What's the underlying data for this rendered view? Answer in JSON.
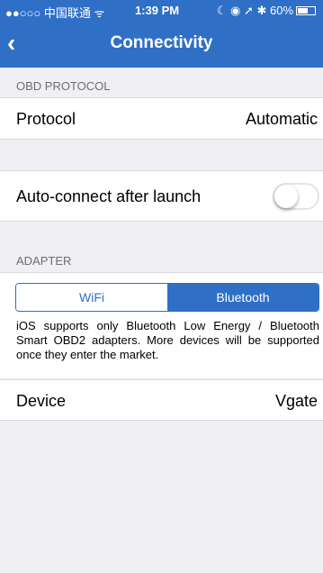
{
  "status_bar": {
    "carrier": "●●○○○ 中国联通 ᯤ",
    "time": "1:39 PM",
    "indicators": "☾ ◉ ➚ ✱ 60%",
    "battery_level": 0.6
  },
  "nav": {
    "back_icon": "chevron-left-icon",
    "title": "Connectivity"
  },
  "obd": {
    "section_label": "OBD PROTOCOL",
    "protocol_label": "Protocol",
    "protocol_value": "Automatic"
  },
  "auto_connect": {
    "label": "Auto-connect after launch",
    "enabled": false
  },
  "adapter": {
    "section_label": "ADAPTER",
    "options": [
      "WiFi",
      "Bluetooth"
    ],
    "selected": "Bluetooth",
    "note": "iOS supports only Bluetooth Low Energy / Bluetooth Smart OBD2 adapters. More devices will be supported once they enter the market."
  },
  "device": {
    "label": "Device",
    "value": "Vgate"
  },
  "colors": {
    "accent": "#2f6fc6",
    "background": "#efeff4"
  }
}
